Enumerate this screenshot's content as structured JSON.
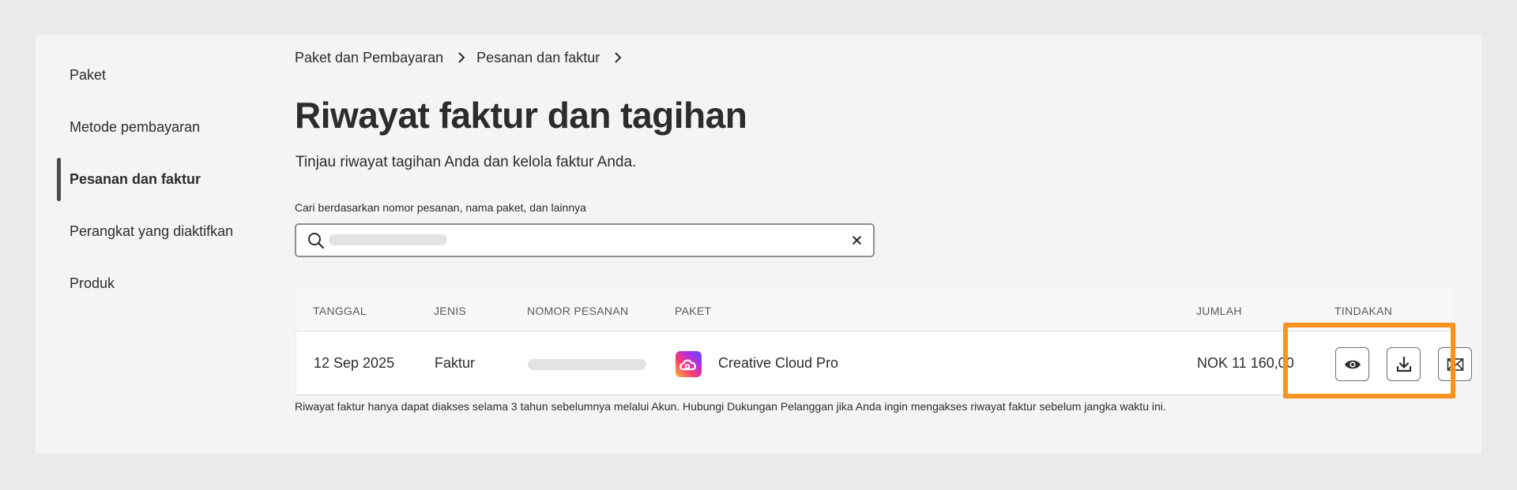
{
  "sidebar": {
    "items": [
      {
        "label": "Paket"
      },
      {
        "label": "Metode pembayaran"
      },
      {
        "label": "Pesanan dan faktur",
        "active": true
      },
      {
        "label": "Perangkat yang diaktifkan"
      },
      {
        "label": "Produk"
      }
    ]
  },
  "breadcrumb": {
    "items": [
      "Paket dan Pembayaran",
      "Pesanan dan faktur"
    ]
  },
  "page": {
    "title": "Riwayat faktur dan tagihan",
    "subtitle": "Tinjau riwayat tagihan Anda dan kelola faktur Anda."
  },
  "search": {
    "label": "Cari berdasarkan nomor pesanan, nama paket, dan lainnya",
    "value": "",
    "placeholder": ""
  },
  "table": {
    "headers": {
      "date": "TANGGAL",
      "type": "JENIS",
      "order": "NOMOR PESANAN",
      "plan": "PAKET",
      "amount": "JUMLAH",
      "actions": "TINDAKAN"
    },
    "rows": [
      {
        "date": "12 Sep 2025",
        "type": "Faktur",
        "order": "",
        "plan": "Creative Cloud Pro",
        "amount": "NOK 11 160,00"
      }
    ],
    "actions": [
      {
        "name": "view",
        "icon": "eye-icon"
      },
      {
        "name": "download",
        "icon": "download-icon"
      },
      {
        "name": "email",
        "icon": "mail-icon"
      }
    ]
  },
  "footnote": "Riwayat faktur hanya dapat diakses selama 3 tahun sebelumnya melalui Akun. Hubungi Dukungan Pelanggan jika Anda ingin mengakses riwayat faktur sebelum jangka waktu ini.",
  "colors": {
    "highlight": "#f7931e",
    "background": "#eaeaea",
    "panel": "#f4f4f4"
  }
}
